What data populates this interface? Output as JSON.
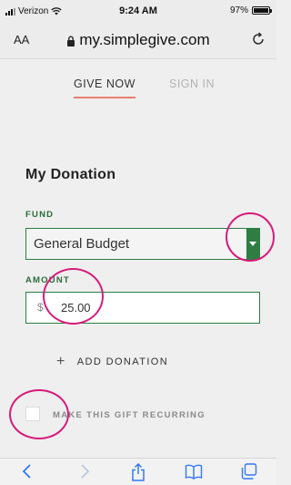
{
  "status_bar": {
    "carrier": "Verizon",
    "time": "9:24 AM",
    "battery_percent": "97%",
    "battery_level": 0.97
  },
  "address_bar": {
    "text_size_label": "AA",
    "url": "my.simplegive.com"
  },
  "tabs": [
    {
      "label": "GIVE NOW",
      "active": true
    },
    {
      "label": "SIGN IN",
      "active": false
    }
  ],
  "form": {
    "title": "My Donation",
    "fund_label": "FUND",
    "fund_value": "General Budget",
    "amount_label": "AMOUNT",
    "currency_symbol": "$",
    "amount_value": "25.00",
    "add_donation_label": "ADD DONATION",
    "recurring_label": "MAKE THIS GIFT RECURRING",
    "recurring_checked": false
  },
  "colors": {
    "accent_green": "#2e7d43",
    "tab_underline": "#e8806f",
    "annotation": "#d81b7a"
  },
  "toolbar": {
    "icons": [
      "back-icon",
      "forward-icon",
      "share-icon",
      "bookmarks-icon",
      "tabs-icon"
    ]
  }
}
